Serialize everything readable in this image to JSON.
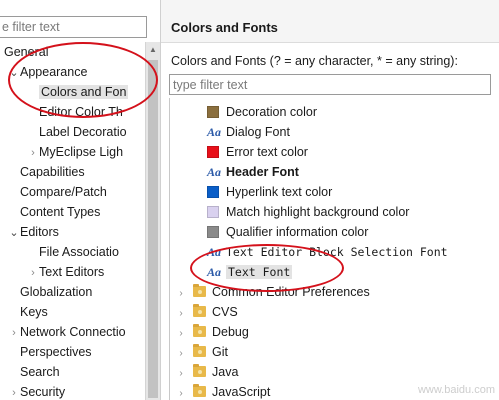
{
  "left_filter": {
    "placeholder": "e filter text"
  },
  "nav": {
    "items": [
      {
        "label": "General",
        "indent": 0,
        "arrow": "none"
      },
      {
        "label": "Appearance",
        "indent": 1,
        "arrow": "open"
      },
      {
        "label": "Colors and Fon",
        "indent": 2,
        "arrow": "none",
        "selected": true
      },
      {
        "label": "Editor Color Th",
        "indent": 2,
        "arrow": "none"
      },
      {
        "label": "Label Decoratio",
        "indent": 2,
        "arrow": "none"
      },
      {
        "label": "MyEclipse Ligh",
        "indent": 2,
        "arrow": "closed"
      },
      {
        "label": "Capabilities",
        "indent": 1,
        "arrow": "none"
      },
      {
        "label": "Compare/Patch",
        "indent": 1,
        "arrow": "none"
      },
      {
        "label": "Content Types",
        "indent": 1,
        "arrow": "none"
      },
      {
        "label": "Editors",
        "indent": 1,
        "arrow": "open"
      },
      {
        "label": "File Associatio",
        "indent": 2,
        "arrow": "none"
      },
      {
        "label": "Text Editors",
        "indent": 2,
        "arrow": "closed"
      },
      {
        "label": "Globalization",
        "indent": 1,
        "arrow": "none"
      },
      {
        "label": "Keys",
        "indent": 1,
        "arrow": "none"
      },
      {
        "label": "Network Connectio",
        "indent": 1,
        "arrow": "closed"
      },
      {
        "label": "Perspectives",
        "indent": 1,
        "arrow": "none"
      },
      {
        "label": "Search",
        "indent": 1,
        "arrow": "none"
      },
      {
        "label": "Security",
        "indent": 1,
        "arrow": "closed"
      }
    ]
  },
  "page": {
    "title": "Colors and Fonts",
    "description": "Colors and Fonts (? = any character, * = any string):",
    "filter_placeholder": "type filter text"
  },
  "items": [
    {
      "label": "Decoration color",
      "kind": "color",
      "color": "#8b6f3e"
    },
    {
      "label": "Dialog Font",
      "kind": "font",
      "icon_text": "Aa"
    },
    {
      "label": "Error text color",
      "kind": "color",
      "color": "#e8101a"
    },
    {
      "label": "Header Font",
      "kind": "font",
      "icon_text": "Aa",
      "bold": true
    },
    {
      "label": "Hyperlink text color",
      "kind": "color",
      "color": "#0a5ec8"
    },
    {
      "label": "Match highlight background color",
      "kind": "color",
      "color": "#d9d1ef"
    },
    {
      "label": "Qualifier information color",
      "kind": "color",
      "color": "#8a8a8a"
    },
    {
      "label": "Text Editor Block Selection Font",
      "kind": "font",
      "icon_text": "Aa",
      "mono": true
    },
    {
      "label": "Text Font",
      "kind": "font",
      "icon_text": "Aa",
      "mono": true,
      "selected": true
    }
  ],
  "categories": [
    {
      "label": "Common Editor Preferences"
    },
    {
      "label": "CVS"
    },
    {
      "label": "Debug"
    },
    {
      "label": "Git"
    },
    {
      "label": "Java"
    },
    {
      "label": "JavaScript"
    }
  ],
  "colors": {
    "annotation": "#d4111b",
    "selection": "#e3e3e3",
    "font_icon": "#2b5aa8"
  },
  "watermark": "www.baidu.com"
}
